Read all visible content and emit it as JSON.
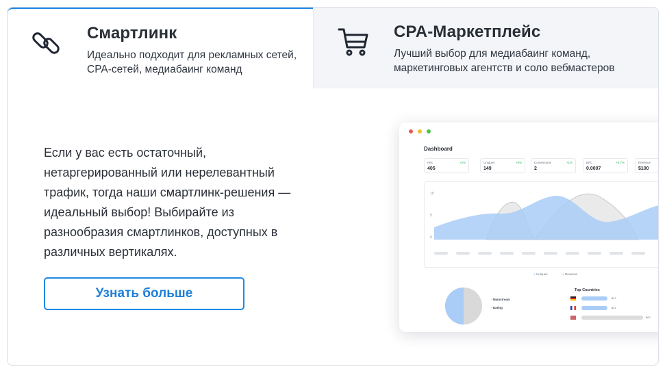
{
  "tabs": [
    {
      "title": "Смартлинк",
      "description": "Идеально подходит для рекламных сетей, CPA-сетей, медиабаинг команд",
      "icon": "link-icon",
      "active": true
    },
    {
      "title": "CPA-Маркетплейс",
      "description": "Лучший выбор для медиабаинг команд, маркетинговых агентств и соло вебмастеров",
      "icon": "cart-icon",
      "active": false
    }
  ],
  "content": {
    "text": "Если у вас есть остаточный, нетаргерированный или нерелевантный трафик, тогда наши смартлинк-решения — идеальный выбор! Выбирайте из разнообразия смартлинков, доступных в различных вертикалях.",
    "cta_label": "Узнать больше"
  },
  "dashboard": {
    "title": "Dashboard",
    "stats": [
      {
        "label": "Hits",
        "change": "+2%",
        "value": "405"
      },
      {
        "label": "Uniques",
        "change": "+5%",
        "value": "149"
      },
      {
        "label": "Conversions",
        "change": "+1%",
        "value": "2"
      },
      {
        "label": "EPC",
        "change": "+6.7%",
        "value": "0.0007"
      },
      {
        "label": "Revenue",
        "change": "",
        "value": "$100"
      }
    ],
    "chart_y_ticks": [
      "10",
      "5",
      "0"
    ],
    "legend": [
      "Uniques",
      "Revenue"
    ],
    "pie_labels": [
      "Mainstream",
      "Dating"
    ],
    "top_countries_title": "Top Countries",
    "top_countries_values": [
      "$19",
      "$21",
      "$60"
    ],
    "top_countries_shares": [
      0.38,
      0.38,
      0.9
    ]
  },
  "colors": {
    "accent": "#1e88e5",
    "series_uniques": "#a9cdf6",
    "series_revenue": "#d9d9d9"
  }
}
